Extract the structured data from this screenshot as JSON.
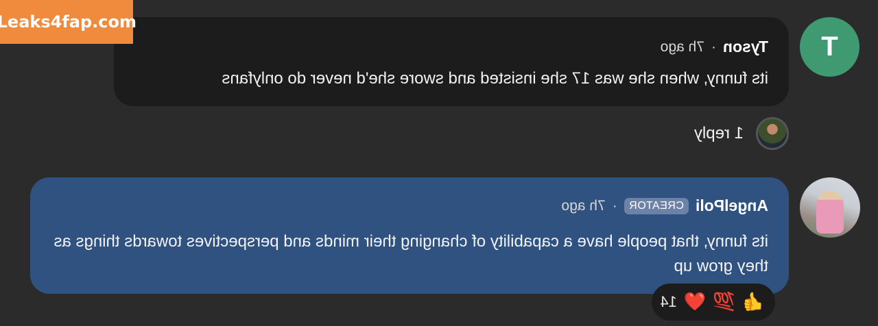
{
  "comments": [
    {
      "avatar_initial": "T",
      "author": "Tyson",
      "time": "7h ago",
      "text": "its funny, when she was 17 she insisted and swore she'd never do onlyfans"
    },
    {
      "author": "AngelPoli",
      "badge": "CREATOR",
      "time": "7h ago",
      "text": "its funny, that people have a capability of changing their minds and perspectives towards things as they grow up"
    }
  ],
  "replies": {
    "label": "1 reply"
  },
  "reactions": {
    "emojis": [
      "👍",
      "💯",
      "❤️"
    ],
    "count": "14"
  },
  "watermark": "Leaks4fap.com",
  "colors": {
    "background": "#2b2b2b",
    "bubble_dark": "#1c1c1c",
    "bubble_creator": "#2f5281",
    "avatar_t": "#3f9a72",
    "badge": "#6d82a8"
  }
}
